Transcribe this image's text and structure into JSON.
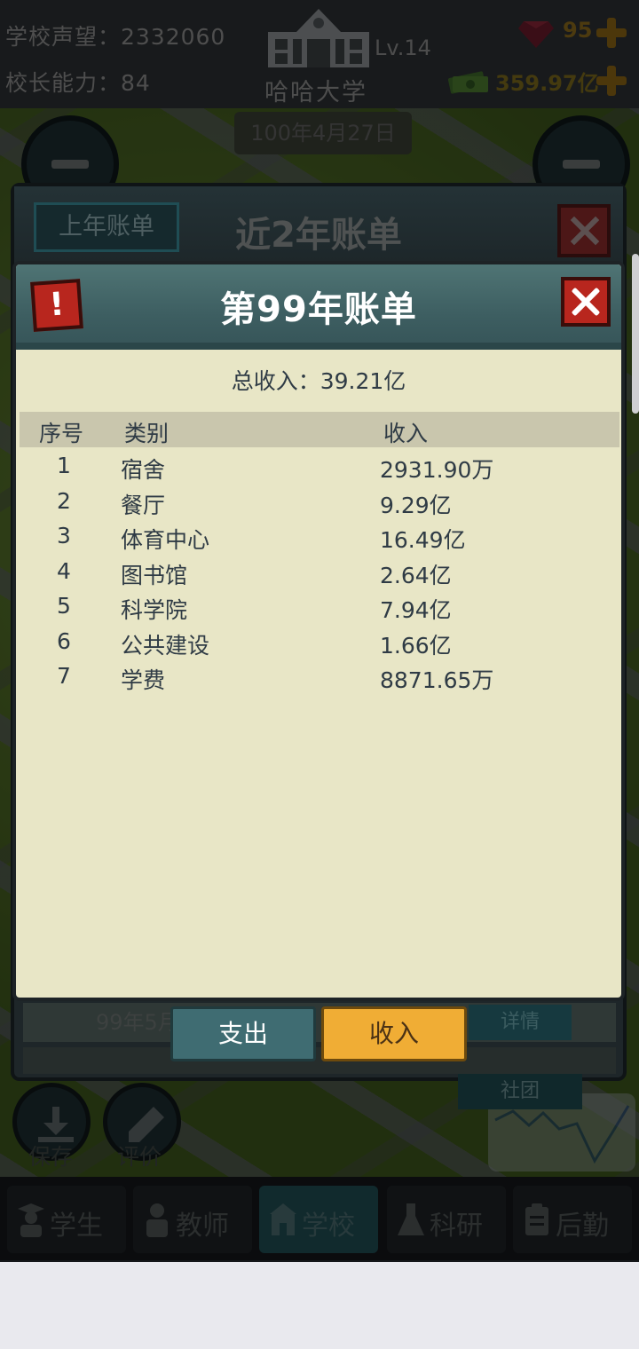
{
  "hud": {
    "reputation": "学校声望：2332060",
    "ability": "校长能力：84",
    "school_level": "Lv.14",
    "school_name": "哈哈大学",
    "gems": "95",
    "cash": "359.97亿"
  },
  "date": "100年4月27日",
  "back_panel": {
    "prev_year_button": "上年账单",
    "title": "近2年账单",
    "row_text": "99年5月",
    "detail_button": "详情",
    "community_tab": "社团"
  },
  "bill": {
    "title": "第99年账单",
    "alert_mark": "!",
    "total_line": "总收入：39.21亿",
    "headers": [
      "序号",
      "类别",
      "收入"
    ],
    "rows": [
      {
        "idx": "1",
        "category": "宿舍",
        "income": "2931.90万"
      },
      {
        "idx": "2",
        "category": "餐厅",
        "income": "9.29亿"
      },
      {
        "idx": "3",
        "category": "体育中心",
        "income": "16.49亿"
      },
      {
        "idx": "4",
        "category": "图书馆",
        "income": "2.64亿"
      },
      {
        "idx": "5",
        "category": "科学院",
        "income": "7.94亿"
      },
      {
        "idx": "6",
        "category": "公共建设",
        "income": "1.66亿"
      },
      {
        "idx": "7",
        "category": "学费",
        "income": "8871.65万"
      }
    ]
  },
  "tabs": {
    "expense": "支出",
    "income": "收入"
  },
  "actions": {
    "save": "保存",
    "review": "评价"
  },
  "nav": {
    "students": "学生",
    "teachers": "教师",
    "school": "学校",
    "research": "科研",
    "logistics": "后勤"
  },
  "colors": {
    "panel_bg": "#e8e6c6",
    "header_teal": "#3d5e61",
    "close_red": "#b8261e",
    "income_tab": "#f0ad35",
    "expense_tab": "#3f6c72"
  }
}
